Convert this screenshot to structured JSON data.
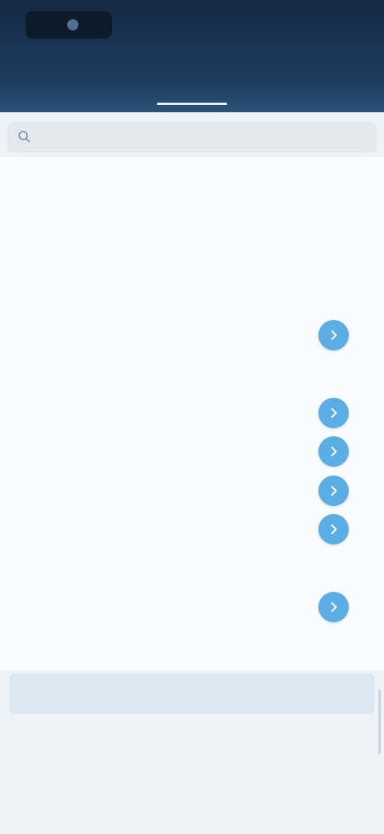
{
  "header": {
    "logo_text": "",
    "action_label": ""
  },
  "tabs": [
    {
      "label": ""
    },
    {
      "label": ""
    }
  ],
  "search": {
    "placeholder": ""
  },
  "list": {
    "section_heading": "",
    "items": [
      {
        "label": "",
        "badge": false
      },
      {
        "label": "",
        "badge": false
      },
      {
        "label": "",
        "badge": false
      },
      {
        "label": "",
        "badge": true
      },
      {
        "label": "",
        "badge": false
      },
      {
        "label": "",
        "badge": true
      },
      {
        "label": "",
        "badge": true
      },
      {
        "label": "",
        "badge": true
      },
      {
        "label": "",
        "badge": true
      },
      {
        "label": "",
        "badge": false
      },
      {
        "label": "",
        "badge": true
      },
      {
        "label": "",
        "badge": false
      }
    ]
  },
  "info_bar": {
    "text": ""
  },
  "section2": {
    "heading": "",
    "item_label": ""
  },
  "colors": {
    "header_top": "#152a43",
    "header_bottom": "#2a5278",
    "accent": "#3f86c6",
    "badge": "#5aaee3",
    "background": "#eef3f7"
  },
  "icons": {
    "search": "search-icon",
    "badge": "chevron-right-icon"
  }
}
